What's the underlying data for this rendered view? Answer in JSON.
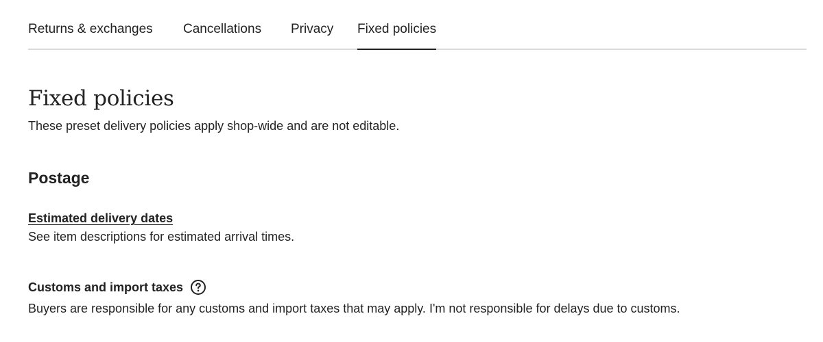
{
  "tabs": [
    {
      "label": "Returns & exchanges",
      "active": false
    },
    {
      "label": "Cancellations",
      "active": false
    },
    {
      "label": "Privacy",
      "active": false
    },
    {
      "label": "Fixed policies",
      "active": true
    }
  ],
  "page": {
    "title": "Fixed policies",
    "subtitle": "These preset delivery policies apply shop-wide and are not editable."
  },
  "postage": {
    "heading": "Postage",
    "delivery": {
      "title": "Estimated delivery dates",
      "description": "See item descriptions for estimated arrival times."
    },
    "customs": {
      "title": "Customs and import taxes",
      "help_icon": "question-circle-icon",
      "description": "Buyers are responsible for any customs and import taxes that may apply. I'm not responsible for delays due to customs."
    }
  },
  "colors": {
    "text": "#222222",
    "divider": "#d9d9d9",
    "background": "#ffffff"
  }
}
